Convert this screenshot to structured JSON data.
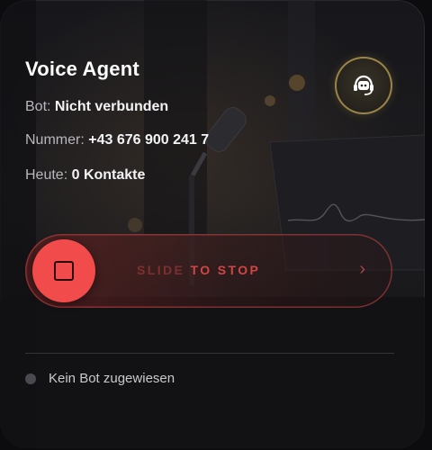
{
  "card": {
    "title": "Voice Agent",
    "bot_label": "Bot:",
    "bot_value": "Nicht verbunden",
    "number_label": "Nummer:",
    "number_value": "+43 676 900 241 7",
    "today_label": "Heute:",
    "today_value": "0 Kontakte",
    "avatar_icon": "headset-bot-icon"
  },
  "slider": {
    "label_part1": "SLIDE ",
    "label_part2": "TO STOP",
    "knob_icon": "stop-icon",
    "arrow_icon": "chevron-right-icon",
    "accent": "#f24b4b"
  },
  "footer": {
    "status_text": "Kein Bot zugewiesen",
    "status_color": "#4a4a50"
  }
}
